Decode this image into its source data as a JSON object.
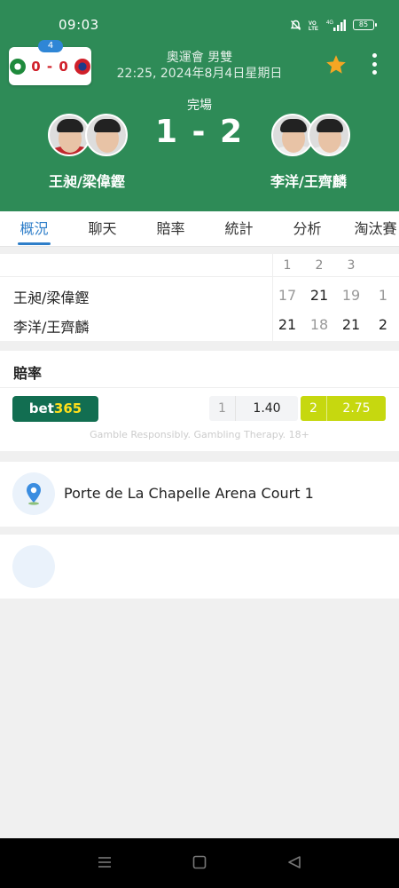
{
  "status_bar": {
    "time": "09:03",
    "signal_label": "4G",
    "battery": "85"
  },
  "mini_score": {
    "badge": "4",
    "text": "0 - 0"
  },
  "event": {
    "title": "奧運會 男雙",
    "datetime": "22:25, 2024年8月4日星期日"
  },
  "match": {
    "status": "完場",
    "score": "1 - 2",
    "home_name": "王昶/梁偉鏗",
    "away_name": "李洋/王齊麟"
  },
  "tabs": [
    "概況",
    "聊天",
    "賠率",
    "統計",
    "分析",
    "淘汰賽"
  ],
  "score_table": {
    "set_headers": [
      "1",
      "2",
      "3"
    ],
    "rows": [
      {
        "name": "王昶/梁偉鏗",
        "sets": [
          "17",
          "21",
          "19"
        ],
        "total": "1"
      },
      {
        "name": "李洋/王齊麟",
        "sets": [
          "21",
          "18",
          "21"
        ],
        "total": "2"
      }
    ]
  },
  "odds": {
    "title": "賠率",
    "bookmaker_part1": "bet",
    "bookmaker_part2": "365",
    "option1_key": "1",
    "option1_value": "1.40",
    "option2_key": "2",
    "option2_value": "2.75",
    "note": "Gamble Responsibly. Gambling Therapy. 18+"
  },
  "venue": {
    "name": "Porte de La Chapelle Arena Court 1"
  },
  "colors": {
    "header_green": "#2e8b57",
    "accent_blue": "#2e7ec9",
    "odds_highlight": "#c6d80f",
    "star": "#f5a623",
    "bet365_green": "#126e51"
  }
}
